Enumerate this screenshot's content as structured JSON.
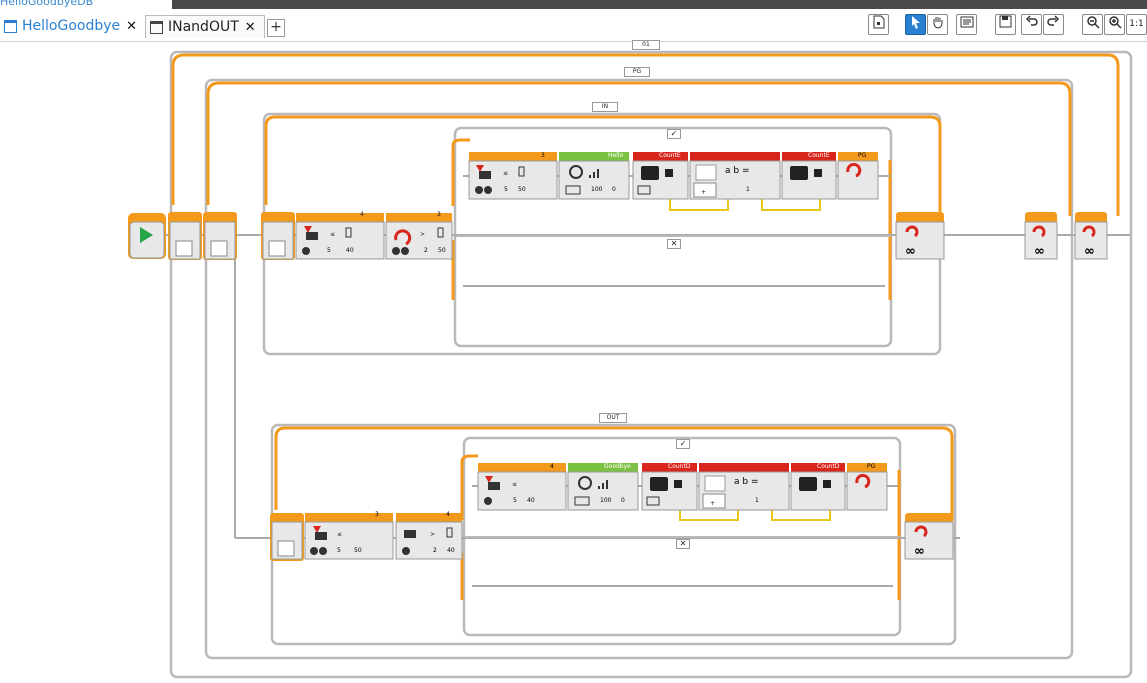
{
  "window": {
    "cut_title": "HelloGoodbyeDB"
  },
  "tabs": [
    {
      "label": "HelloGoodbye",
      "close": "✕"
    },
    {
      "label": "INandOUT",
      "close": "✕"
    }
  ],
  "add_tab": "+",
  "toolbar": {
    "zoom_reset": "1:1"
  },
  "loops": {
    "outer1": "01",
    "pg": "PG",
    "in": "IN",
    "out": "OUT"
  },
  "switch_true": "✓",
  "switch_false": "✕",
  "in_row": {
    "wait_header": "4",
    "wait_vals": [
      "5",
      "40"
    ],
    "loopint_header": "3",
    "loopint_vals": [
      "2",
      "50"
    ],
    "sw_wait_header": "3",
    "sw_wait_vals": [
      "5",
      "50"
    ],
    "sound_header": "Hello",
    "sound_vals": [
      "100",
      "0"
    ],
    "var_header": "CountE",
    "math_sym": "a b =",
    "math_val": "1",
    "var2_header": "CountE",
    "loopint2_header": "PG",
    "loop_sym": "∞"
  },
  "out_row": {
    "wait_header": "3",
    "wait_vals": [
      "5",
      "50"
    ],
    "loopint_header": "4",
    "loopint_vals": [
      "2",
      "40"
    ],
    "sw_wait_header": "4",
    "sw_wait_vals": [
      "5",
      "40"
    ],
    "sound_header": "Goodbye",
    "sound_vals": [
      "100",
      "0"
    ],
    "var_header": "CountD",
    "math_val": "1",
    "var2_header": "CountD",
    "loopint2_header": "PG",
    "loop_sym": "∞"
  },
  "colors": {
    "orange": "#f39a1d",
    "green": "#7cc242",
    "red": "#d9261c",
    "blue_tab": "#2a7fd0",
    "wire_yellow": "#e6c619"
  }
}
